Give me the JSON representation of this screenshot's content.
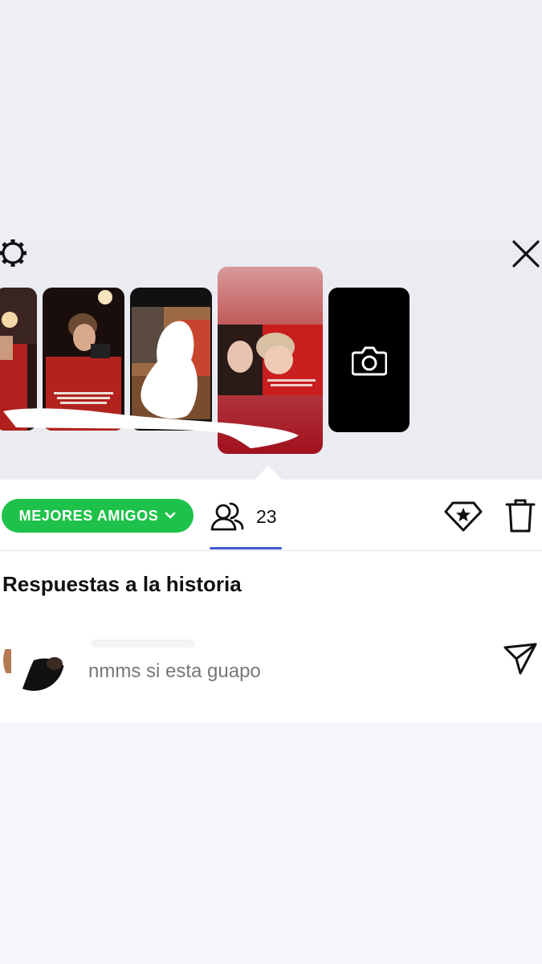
{
  "story_tray": {
    "settings_icon": "gear-icon",
    "close_icon": "close-icon",
    "add_story_icon": "camera-icon",
    "thumbnails": [
      {
        "name": "story-thumb-1"
      },
      {
        "name": "story-thumb-2"
      },
      {
        "name": "story-thumb-3"
      },
      {
        "name": "story-thumb-4",
        "selected": true
      }
    ]
  },
  "toolbar": {
    "audience_label": "MEJORES AMIGOS",
    "audience_color": "#1ec24a",
    "viewers_icon": "viewers-icon",
    "viewers_count": "23",
    "tab_accent": "#3c5bd1",
    "highlight_icon": "highlight-star-icon",
    "delete_icon": "trash-icon"
  },
  "replies": {
    "title": "Respuestas a la historia",
    "items": [
      {
        "message": "nmms si esta guapo",
        "action_icon": "send-icon"
      }
    ]
  }
}
